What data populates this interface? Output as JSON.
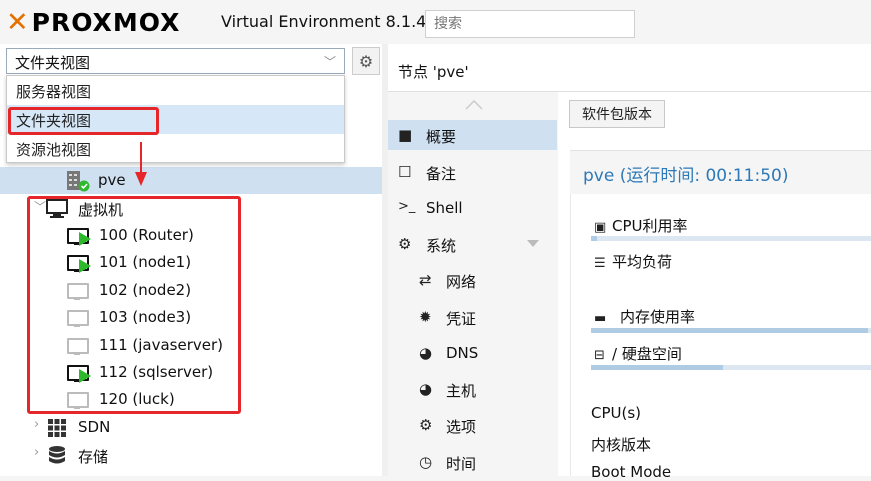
{
  "header": {
    "logo_text": "PROXMOX",
    "product": "Virtual Environment 8.1.4",
    "search_placeholder": "搜索"
  },
  "tree": {
    "view_selected": "文件夹视图",
    "view_options": [
      "服务器视图",
      "文件夹视图",
      "资源池视图"
    ],
    "node_label": "pve",
    "vm_group_label": "虚拟机",
    "vms": [
      {
        "label": "100 (Router)",
        "running": true
      },
      {
        "label": "101 (node1)",
        "running": true
      },
      {
        "label": "102 (node2)",
        "running": false
      },
      {
        "label": "103 (node3)",
        "running": false
      },
      {
        "label": "111 (javaserver)",
        "running": false
      },
      {
        "label": "112 (sqlserver)",
        "running": true
      },
      {
        "label": "120 (luck)",
        "running": false
      }
    ],
    "sdn_label": "SDN",
    "storage_label": "存储"
  },
  "node": {
    "title": "节点 'pve'"
  },
  "nav": {
    "items": [
      {
        "label": "概要",
        "icon": "book-icon"
      },
      {
        "label": "备注",
        "icon": "note-icon"
      },
      {
        "label": "Shell",
        "icon": "terminal-icon"
      },
      {
        "label": "系统",
        "icon": "cogs-icon"
      },
      {
        "label": "网络",
        "icon": "exchange-icon"
      },
      {
        "label": "凭证",
        "icon": "certificate-icon"
      },
      {
        "label": "DNS",
        "icon": "globe-icon"
      },
      {
        "label": "主机",
        "icon": "globe-icon"
      },
      {
        "label": "选项",
        "icon": "gear-icon"
      },
      {
        "label": "时间",
        "icon": "clock-icon"
      }
    ]
  },
  "content": {
    "package_button": "软件包版本",
    "summary_title": "pve (运行时间: 00:11:50)",
    "cpu_label": "CPU利用率",
    "load_label": "平均负荷",
    "mem_label": "内存使用率",
    "disk_label": "/ 硬盘空间",
    "cpus_label": "CPU(s)",
    "kernel_label": "内核版本",
    "boot_label": "Boot Mode",
    "cpu_usage": 0.02,
    "mem_usage": 0.99,
    "disk_usage": 0.47
  },
  "colors": {
    "accent": "#2d78b7",
    "logo_x": "#e57000",
    "annotation_red": "#e5262a",
    "running_green": "#2eb82e"
  }
}
